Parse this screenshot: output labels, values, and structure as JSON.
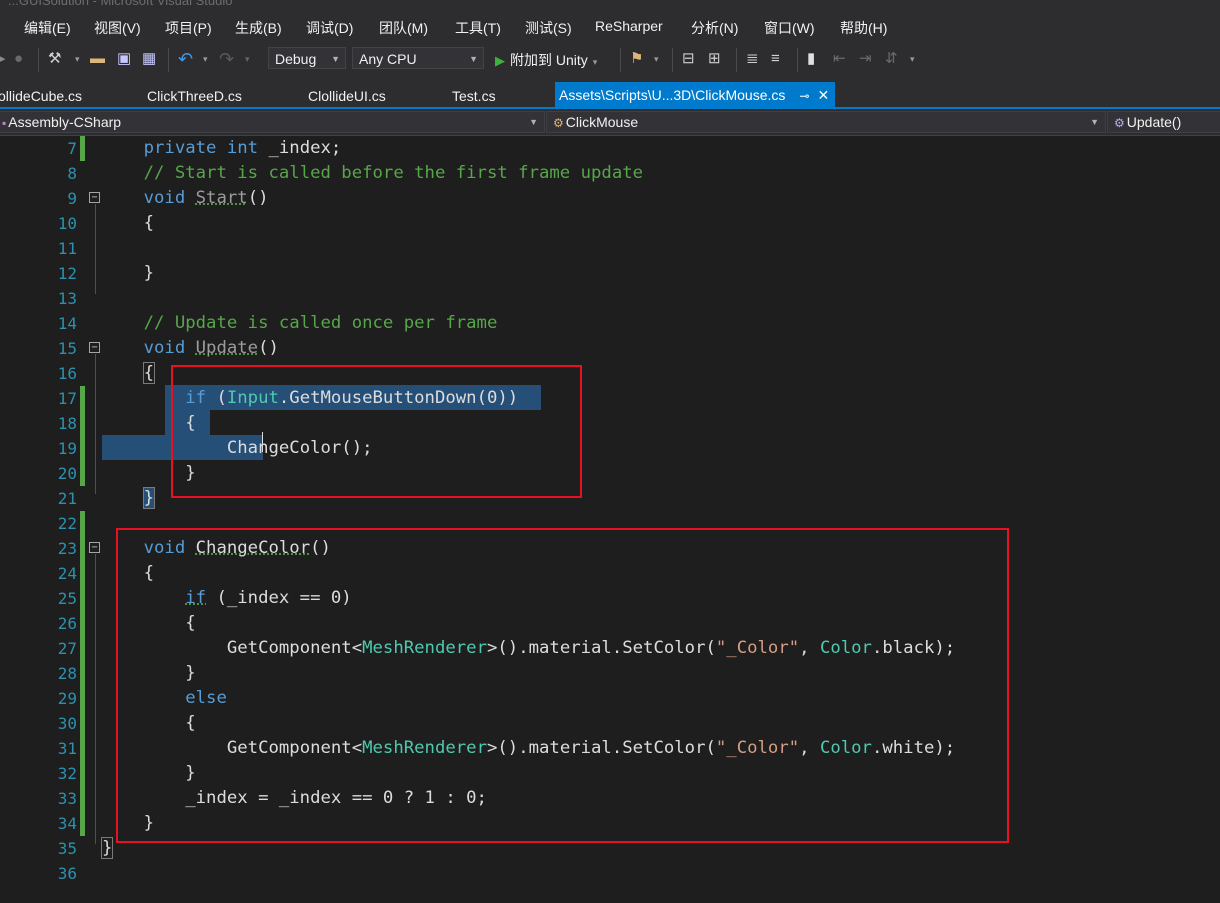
{
  "window": {
    "title": "...GUISolution - Microsoft Visual Studio"
  },
  "menu": [
    "编辑(E)",
    "视图(V)",
    "项目(P)",
    "生成(B)",
    "调试(D)",
    "团队(M)",
    "工具(T)",
    "测试(S)",
    "ReSharper",
    "分析(N)",
    "窗口(W)",
    "帮助(H)"
  ],
  "toolbar": {
    "config": "Debug",
    "platform": "Any CPU",
    "attach_label": "附加到 Unity"
  },
  "tabs": [
    {
      "label": "ollideCube.cs"
    },
    {
      "label": "ClickThreeD.cs"
    },
    {
      "label": "ClollideUI.cs"
    },
    {
      "label": "Test.cs"
    },
    {
      "label": "Assets\\Scripts\\U...3D\\ClickMouse.cs",
      "active": true
    }
  ],
  "nav": {
    "project": "Assembly-CSharp",
    "type": "ClickMouse",
    "member": "Update()"
  },
  "code": {
    "line_numbers": [
      "7",
      "8",
      "9",
      "10",
      "11",
      "12",
      "13",
      "14",
      "15",
      "16",
      "17",
      "18",
      "19",
      "20",
      "21",
      "22",
      "23",
      "24",
      "25",
      "26",
      "27",
      "28",
      "29",
      "30",
      "31",
      "32",
      "33",
      "34",
      "35",
      "36"
    ],
    "private_kw": "private",
    "int_kw": "int",
    "index_field": " _index;",
    "comment_start": "// Start is called before the first frame update",
    "void_kw": "void",
    "start_name": "Start",
    "parens": "()",
    "open_brace": "{",
    "close_brace": "}",
    "comment_update": "// Update is called once per frame",
    "update_name": "Update",
    "if_kw": "if",
    "input_type": "Input",
    "get_mouse": ".GetMouseButtonDown(0))",
    "open_paren": " (",
    "change_call": "ChangeColor();",
    "changecolor_name": "ChangeColor",
    "index_cond": " (_index == 0)",
    "getcomponent": "GetComponent<",
    "meshrenderer": "MeshRenderer",
    "material_setcolor": ">().material.SetColor(",
    "color_string": "\"_Color\"",
    "comma": ", ",
    "color_type": "Color",
    "black_tail": ".black);",
    "white_tail": ".white);",
    "else_kw": "else",
    "toggle_line": "_index = _index == 0 ? 1 : 0;"
  }
}
